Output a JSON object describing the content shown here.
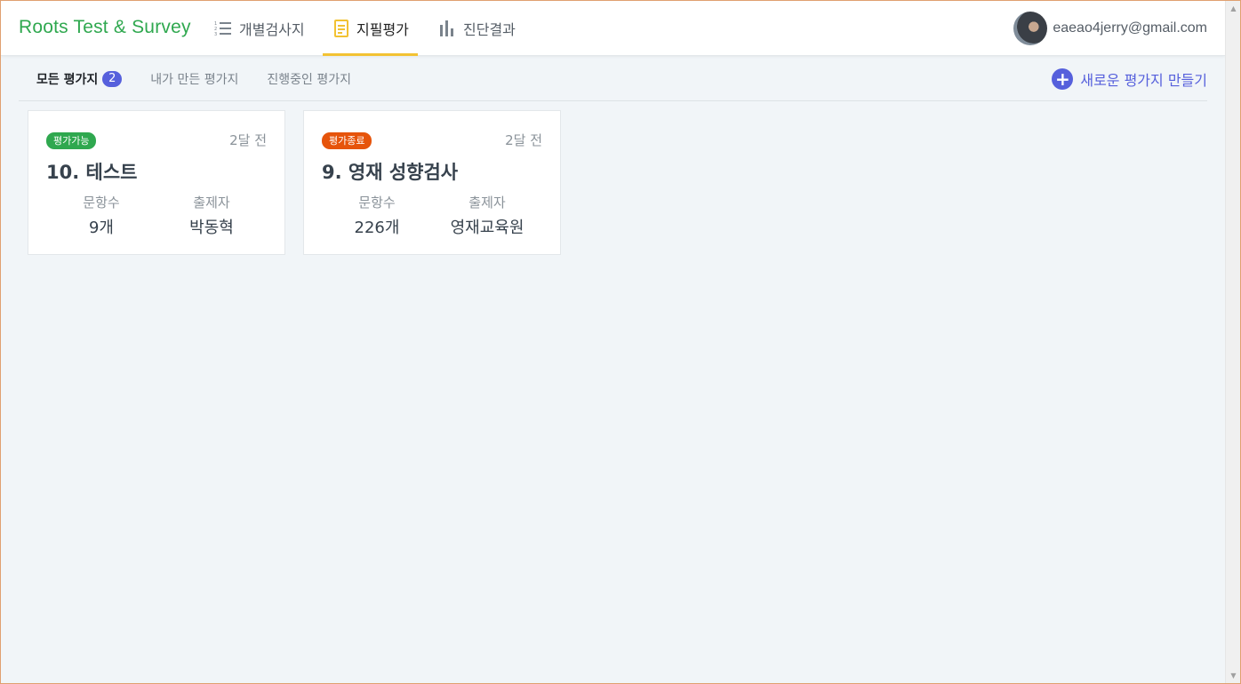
{
  "navbar": {
    "brand": "Roots Test & Survey",
    "items": [
      {
        "label": "개별검사지",
        "icon": "list-numbered-icon"
      },
      {
        "label": "지필평가",
        "icon": "document-icon"
      },
      {
        "label": "진단결과",
        "icon": "bar-chart-icon"
      }
    ],
    "active_index": 1,
    "user_email": "eaeao4jerry@gmail.com"
  },
  "subnav": {
    "tabs": [
      {
        "label": "모든 평가지",
        "count": "2"
      },
      {
        "label": "내가 만든 평가지"
      },
      {
        "label": "진행중인 평가지"
      }
    ],
    "new_button_label": "새로운 평가지 만들기"
  },
  "cards": [
    {
      "status": "평가가능",
      "status_color": "#2fa84f",
      "time_ago": "2달 전",
      "title": "10. 테스트",
      "stats": [
        {
          "label": "문항수",
          "value": "9개"
        },
        {
          "label": "출제자",
          "value": "박동혁"
        }
      ]
    },
    {
      "status": "평가종료",
      "status_color": "#e6540b",
      "time_ago": "2달 전",
      "title": "9. 영재 성향검사",
      "stats": [
        {
          "label": "문항수",
          "value": "226개"
        },
        {
          "label": "출제자",
          "value": "영재교육원"
        }
      ]
    }
  ],
  "colors": {
    "brand": "#2fa84f",
    "accent": "#5660dc",
    "active_underline": "#f2c233"
  }
}
